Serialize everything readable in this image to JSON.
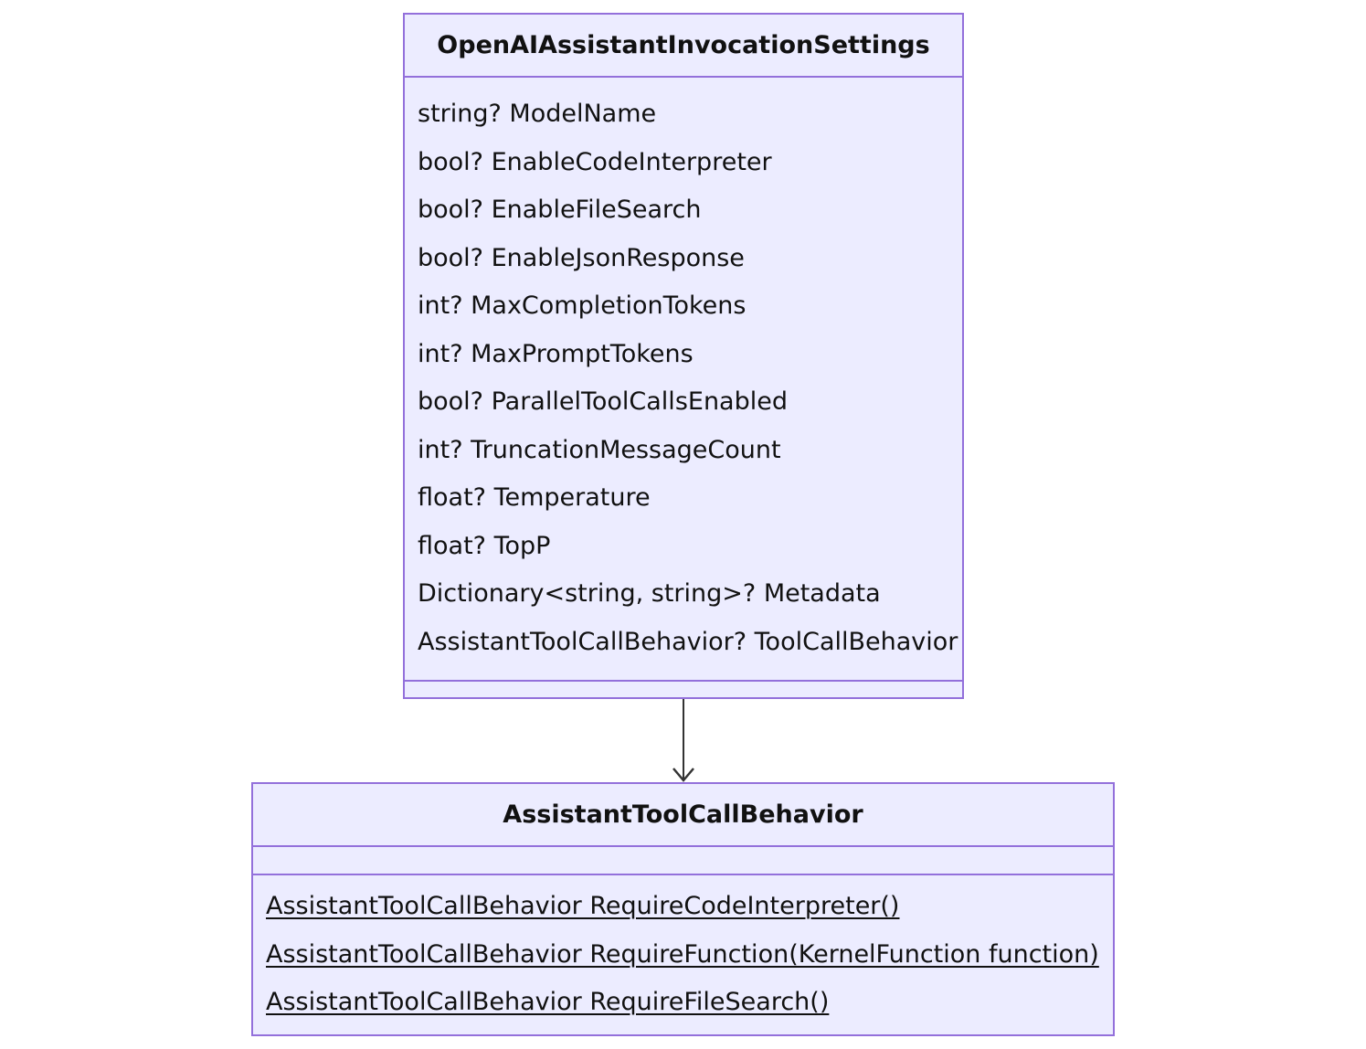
{
  "classes": {
    "settings": {
      "name": "OpenAIAssistantInvocationSettings",
      "attributes": [
        "string? ModelName",
        "bool? EnableCodeInterpreter",
        "bool? EnableFileSearch",
        "bool? EnableJsonResponse",
        "int? MaxCompletionTokens",
        "int? MaxPromptTokens",
        "bool? ParallelToolCallsEnabled",
        "int? TruncationMessageCount",
        "float? Temperature",
        "float? TopP",
        "Dictionary<string, string>? Metadata",
        "AssistantToolCallBehavior? ToolCallBehavior"
      ],
      "methods": []
    },
    "behavior": {
      "name": "AssistantToolCallBehavior",
      "attributes": [],
      "methods": [
        "AssistantToolCallBehavior RequireCodeInterpreter()",
        "AssistantToolCallBehavior RequireFunction(KernelFunction function)",
        "AssistantToolCallBehavior RequireFileSearch()"
      ]
    }
  },
  "relations": [
    {
      "from": "OpenAIAssistantInvocationSettings",
      "to": "AssistantToolCallBehavior",
      "type": "association",
      "arrow": "open"
    }
  ],
  "colors": {
    "box_fill": "#ececff",
    "box_border": "#9370db",
    "arrow": "#333333",
    "text": "#111111"
  }
}
